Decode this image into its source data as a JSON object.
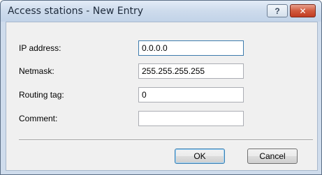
{
  "window": {
    "title": "Access stations - New Entry",
    "help_label": "?",
    "close_label": "✕"
  },
  "form": {
    "fields": [
      {
        "label": "IP address:",
        "value": "0.0.0.0"
      },
      {
        "label": "Netmask:",
        "value": "255.255.255.255"
      },
      {
        "label": "Routing tag:",
        "value": "0"
      },
      {
        "label": "Comment:",
        "value": ""
      }
    ]
  },
  "buttons": {
    "ok_label": "OK",
    "cancel_label": "Cancel"
  },
  "colors": {
    "title_bar": "#cddbec",
    "client_background": "#f0f0f0",
    "close_button": "#c23c22",
    "focus_border": "#3d7bad"
  }
}
